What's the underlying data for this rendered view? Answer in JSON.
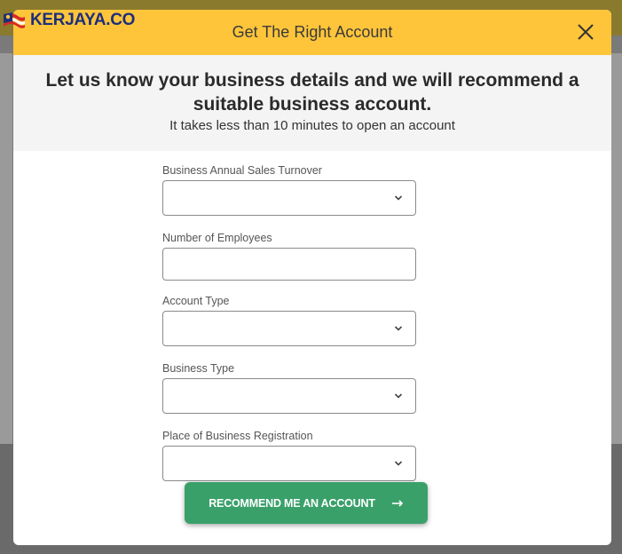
{
  "brand": {
    "logo_text": "KERJAYA.CO"
  },
  "modal": {
    "title": "Get The Right Account",
    "heading": "Let us know your business details and we will recommend a suitable business account.",
    "subheading": "It takes less than 10 minutes to open an account"
  },
  "form": {
    "fields": [
      {
        "label": "Business Annual Sales Turnover",
        "type": "select",
        "value": ""
      },
      {
        "label": "Number of Employees",
        "type": "input",
        "value": ""
      },
      {
        "label": "Account Type",
        "type": "select",
        "value": ""
      },
      {
        "label": "Business Type",
        "type": "select",
        "value": ""
      },
      {
        "label": "Place of Business Registration",
        "type": "select",
        "value": ""
      }
    ],
    "submit_label": "RECOMMEND ME AN ACCOUNT"
  },
  "icons": {
    "close": "close-icon",
    "chevron": "chevron-down-icon",
    "arrow": "arrow-right-icon"
  },
  "colors": {
    "header": "#ffc53a",
    "submit": "#3aa06a",
    "brand": "#1d2f7a"
  }
}
